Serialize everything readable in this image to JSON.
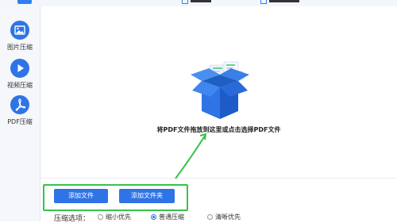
{
  "sidebar": {
    "items": [
      {
        "label": "图片压缩",
        "icon": "image-icon"
      },
      {
        "label": "视频压缩",
        "icon": "play-icon"
      },
      {
        "label": "PDF压缩",
        "icon": "pdf-icon"
      }
    ]
  },
  "drop_zone": {
    "text": "将PDF文件拖放到这里或点击选择PDF文件",
    "illustration": "open-box-icon"
  },
  "buttons": {
    "add_file": "添加文件",
    "add_folder": "添加文件夹"
  },
  "compression": {
    "label": "压缩选项：",
    "options": [
      {
        "label": "缩小优先",
        "checked": false
      },
      {
        "label": "普通压缩",
        "checked": true
      },
      {
        "label": "清晰优先",
        "checked": false
      }
    ]
  },
  "colors": {
    "accent": "#2f74e6",
    "highlight": "#37c24b",
    "sidebar_bg": "#f5f7fb"
  }
}
